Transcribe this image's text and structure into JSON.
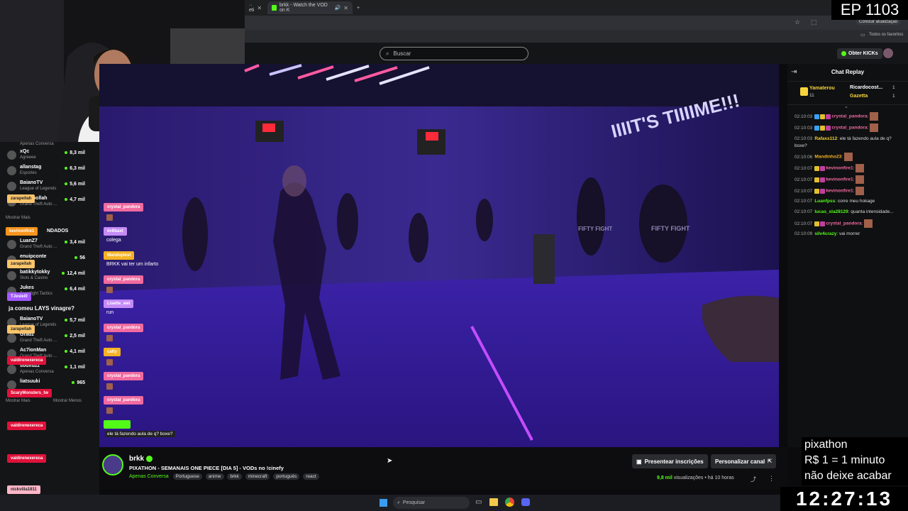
{
  "browser": {
    "tabs": [
      {
        "label": "·· eti"
      },
      {
        "label": "brkk - Watch the VOD on K"
      }
    ],
    "profile_button": "Concluir atualização",
    "favorites_label": "Todos os favoritos"
  },
  "header": {
    "search_placeholder": "Buscar",
    "get_kicks_label": "Obter KICKs"
  },
  "sidebar": {
    "top_category": "Apenas Conversa",
    "channels": [
      {
        "name": "xQc",
        "category": "Agreeee",
        "viewers": "8,3 mil"
      },
      {
        "name": "allanstag",
        "category": "Esportes",
        "viewers": "6,3 mil"
      },
      {
        "name": "BaianoTV",
        "category": "League of Legends",
        "viewers": "5,6 mil"
      },
      {
        "name": "zaraspollah",
        "category": "Grand Theft Auto ...",
        "viewers": "4,7 mil"
      },
      {
        "name": "LuanZ7",
        "category": "Grand Theft Auto ...",
        "viewers": "3,4 mil"
      },
      {
        "name": "enuipconte",
        "category": "",
        "viewers": "56"
      },
      {
        "name": "batikkytokky",
        "category": "Slots & Casino",
        "viewers": "12,4 mil"
      },
      {
        "name": "Jukes",
        "category": "Teamfight Tactics",
        "viewers": "6,4 mil"
      },
      {
        "name": "BaianoTV",
        "category": "League of Legends",
        "viewers": "5,7 mil"
      },
      {
        "name": "Gradz",
        "category": "Grand Theft Auto ...",
        "viewers": "2,5 mil"
      },
      {
        "name": "Ac7ionMan",
        "category": "Grand Theft Auto ...",
        "viewers": "4,1 mil"
      },
      {
        "name": "soulfuzz",
        "category": "Apenas Conversa",
        "viewers": "1,1 mil"
      },
      {
        "name": "liatsuuki",
        "category": "",
        "viewers": "965"
      }
    ],
    "show_more": "Mostrar Mais",
    "recommended": "NDADOS",
    "show_more_2": "Mostrar Mais",
    "show_less": "Mostrar Menos"
  },
  "overlay_chat": [
    {
      "user": "kevinonfire1",
      "color": "#f7941d",
      "text": ""
    },
    {
      "user": "zarapellah",
      "color": "#f9c46b",
      "text": ""
    },
    {
      "user": "zarapellah",
      "color": "#f9c46b",
      "text": ""
    },
    {
      "user": "TJeslei0",
      "color": "#a259ff",
      "text": ""
    },
    {
      "user": "",
      "color": "",
      "text": "ja comeu LAYS vinagre?"
    },
    {
      "user": "zarapellah",
      "color": "#f9c46b",
      "text": ""
    },
    {
      "user": "valdirenexereca",
      "color": "#e0113a",
      "text": ""
    },
    {
      "user": "ScaryMonsters_tw",
      "color": "#e0113a",
      "text": ""
    },
    {
      "user": "valdirenexereca",
      "color": "#e0113a",
      "text": ""
    },
    {
      "user": "valdirenexereca",
      "color": "#e0113a",
      "text": ""
    },
    {
      "user": "nickvilla1811",
      "color": "#ffb6c8",
      "text": ""
    }
  ],
  "video_overlay_chat": [
    {
      "user": "crystal_pandora",
      "color": "#f06aa0",
      "text": ""
    },
    {
      "user": "m4lbaxt",
      "color": "#c58cf6",
      "text": "colega"
    },
    {
      "user": "Mandoplest",
      "color": "#f5b324",
      "text": "BRKK vai ter um infarto"
    },
    {
      "user": "crystal_pandora",
      "color": "#f06aa0",
      "text": ""
    },
    {
      "user": "Lisette_wel",
      "color": "#c58cf6",
      "text": "run"
    },
    {
      "user": "crystal_pandora",
      "color": "#f06aa0",
      "text": ""
    },
    {
      "user": "catty",
      "color": "#f5b324",
      "text": ""
    },
    {
      "user": "crystal_pandora",
      "color": "#f06aa0",
      "text": ""
    },
    {
      "user": "crystal_pandora",
      "color": "#f06aa0",
      "text": ""
    },
    {
      "user": "",
      "color": "#53fc18",
      "text": "ele tá fazendo aula de q? boxe?"
    }
  ],
  "video": {
    "wall_text": "IIIIT'S TIIIIME!!!",
    "bag_label_1": "FIFTY FIGHT",
    "bag_label_2": "FIFTY FIGHT"
  },
  "chat": {
    "title": "Chat Replay",
    "gifter_1": {
      "name": "Yamaterou",
      "count": "11"
    },
    "gifter_2": {
      "name": "Ricardocost...",
      "count": "1"
    },
    "gifter_3": {
      "name": "Gazetta",
      "count": "1"
    },
    "messages": [
      {
        "time": "02:10:03",
        "user": "crystal_pandora",
        "color": "#f06aa0",
        "text": ""
      },
      {
        "time": "02:10:03",
        "user": "crystal_pandora",
        "color": "#f06aa0",
        "text": ""
      },
      {
        "time": "02:10:03",
        "user": "Rafaxs112",
        "color": "#f5d33a",
        "text": "ele tá fazendo aula de q? boxe?"
      },
      {
        "time": "02:10:06",
        "user": "Mandinho23",
        "color": "#f5b324",
        "text": ""
      },
      {
        "time": "02:10:07",
        "user": "kevinonfire1",
        "color": "#f06aa0",
        "text": ""
      },
      {
        "time": "02:10:07",
        "user": "kevinonfire1",
        "color": "#f06aa0",
        "text": ""
      },
      {
        "time": "02:10:07",
        "user": "kevinonfire1",
        "color": "#f06aa0",
        "text": ""
      },
      {
        "time": "02:10:07",
        "user": "Luanfpss",
        "color": "#53fc18",
        "text": "corre meu hokage"
      },
      {
        "time": "02:10:07",
        "user": "lucas_sla28129",
        "color": "#53fc18",
        "text": "quanta intensidade..."
      },
      {
        "time": "02:10:07",
        "user": "crystal_pandora",
        "color": "#f06aa0",
        "text": ""
      },
      {
        "time": "02:10:09",
        "user": "silv4crazy",
        "color": "#53fc18",
        "text": "vai morrer"
      }
    ]
  },
  "stream_info": {
    "channel": "brkk",
    "title": "PIXATHON - SEMANAIS ONE PIECE [DIA 5] - VODs no !cinefy",
    "category": "Apenas Conversa",
    "tags": [
      "Portuguese",
      "anime",
      "brkk",
      "minecraft",
      "português",
      "react"
    ],
    "gift_subs_label": "Presentear inscrições",
    "customize_label": "Personalizar canal",
    "views": "9,8 mil",
    "views_label": "visualizações",
    "age": "há 10 horas"
  },
  "stream_overlay": {
    "episode": "EP 1103",
    "pixathon_line_1": "pixathon",
    "pixathon_line_2": "R$ 1 = 1 minuto",
    "pixathon_line_3": "não deixe acabar",
    "clock": "12:27:13"
  },
  "taskbar": {
    "search_label": "Pesquisar"
  },
  "colors": {
    "kick_green": "#53fc18",
    "video_purple": "#2a1680",
    "sidebar_bg": "#141517"
  }
}
